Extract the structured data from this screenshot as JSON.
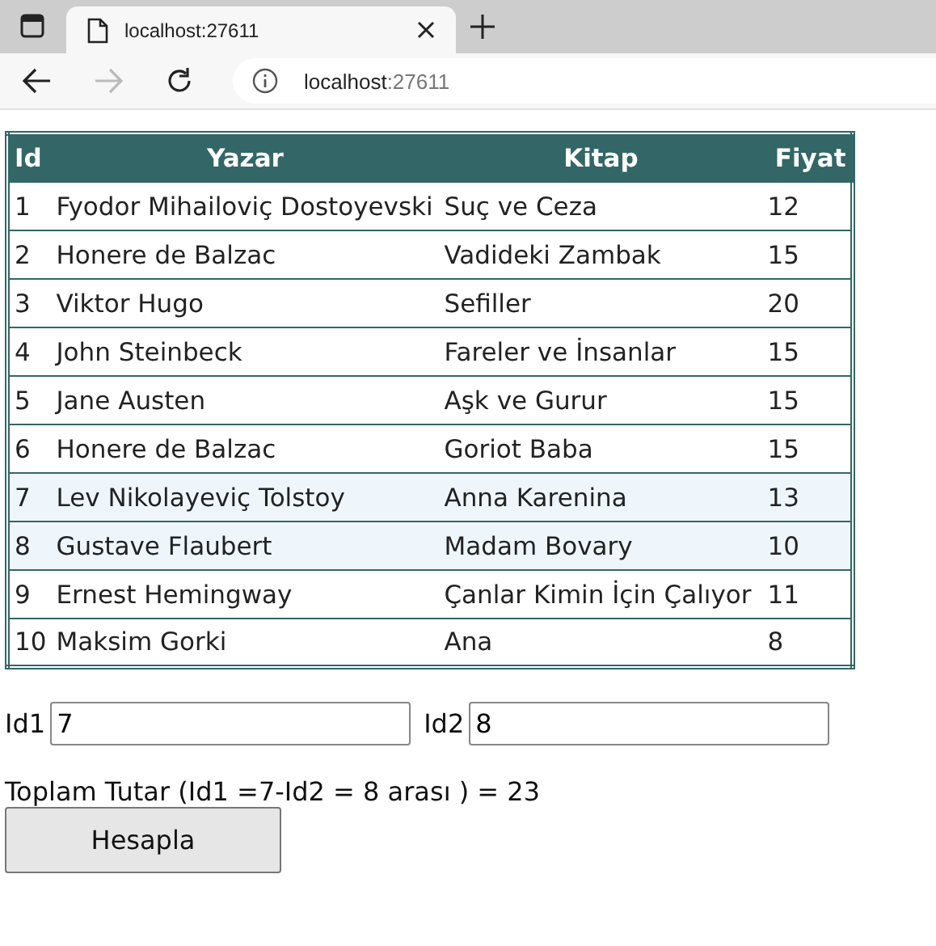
{
  "browser": {
    "tab_title": "localhost:27611",
    "address_host": "localhost",
    "address_port": ":27611"
  },
  "table": {
    "columns": [
      "Id",
      "Yazar",
      "Kitap",
      "Fiyat"
    ],
    "rows": [
      {
        "cells": [
          "1",
          "Fyodor Mihailoviç Dostoyevski",
          "Suç ve Ceza",
          "12"
        ],
        "highlighted": false
      },
      {
        "cells": [
          "2",
          "Honere de Balzac",
          "Vadideki Zambak",
          "15"
        ],
        "highlighted": false
      },
      {
        "cells": [
          "3",
          "Viktor Hugo",
          "Sefiller",
          "20"
        ],
        "highlighted": false
      },
      {
        "cells": [
          "4",
          "John Steinbeck",
          "Fareler ve İnsanlar",
          "15"
        ],
        "highlighted": false
      },
      {
        "cells": [
          "5",
          "Jane Austen",
          "Aşk ve Gurur",
          "15"
        ],
        "highlighted": false
      },
      {
        "cells": [
          "6",
          "Honere de Balzac",
          "Goriot Baba",
          "15"
        ],
        "highlighted": false
      },
      {
        "cells": [
          "7",
          "Lev Nikolayeviç Tolstoy",
          "Anna Karenina",
          "13"
        ],
        "highlighted": true
      },
      {
        "cells": [
          "8",
          "Gustave Flaubert",
          "Madam Bovary",
          "10"
        ],
        "highlighted": true
      },
      {
        "cells": [
          "9",
          "Ernest Hemingway",
          "Çanlar Kimin İçin Çalıyor",
          "11"
        ],
        "highlighted": false
      },
      {
        "cells": [
          "10",
          "Maksim Gorki",
          "Ana",
          "8"
        ],
        "highlighted": false
      }
    ]
  },
  "form": {
    "fields": [
      {
        "label": "Id1",
        "value": "7"
      },
      {
        "label": "Id2",
        "value": "8"
      }
    ],
    "result": "Toplam Tutar (Id1 =7-Id2 = 8 arası ) = 23",
    "button": "Hesapla"
  }
}
